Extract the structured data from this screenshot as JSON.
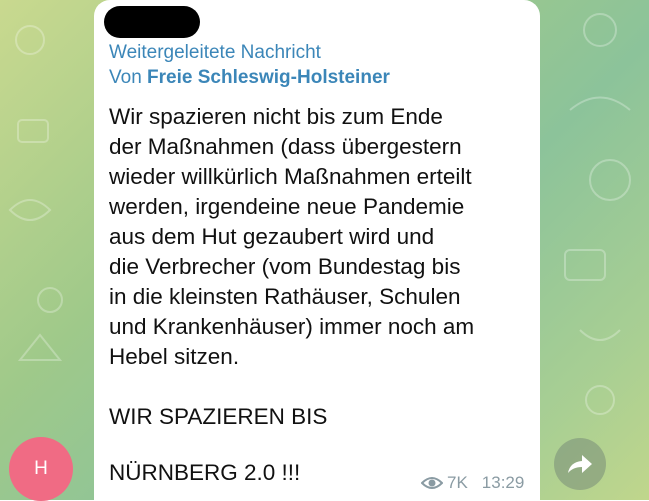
{
  "forward": {
    "header": "Weitergeleitete Nachricht",
    "prefix": "Von ",
    "source": "Freie Schleswig-Holsteiner"
  },
  "message": {
    "lines": [
      "Wir spazieren nicht bis zum Ende",
      "der Maßnahmen (dass übergestern",
      "wieder willkürlich Maßnahmen erteilt",
      "werden, irgendeine neue Pandemie",
      "aus dem Hut gezaubert wird und",
      "die Verbrecher (vom Bundestag bis",
      "in die kleinsten Rathäuser, Schulen",
      "und Krankenhäuser) immer noch am",
      "Hebel sitzen.",
      "WIR SPAZIEREN BIS",
      "NÜRNBERG 2.0 !!!"
    ]
  },
  "meta": {
    "views": "7K",
    "time": "13:29"
  },
  "avatar": {
    "initial": "H"
  },
  "colors": {
    "accent": "#3b86b8",
    "avatar_bg": "#f06b84",
    "meta_text": "#8a9ba3"
  },
  "icons": {
    "views": "eye-icon",
    "share": "share-forward-icon"
  }
}
